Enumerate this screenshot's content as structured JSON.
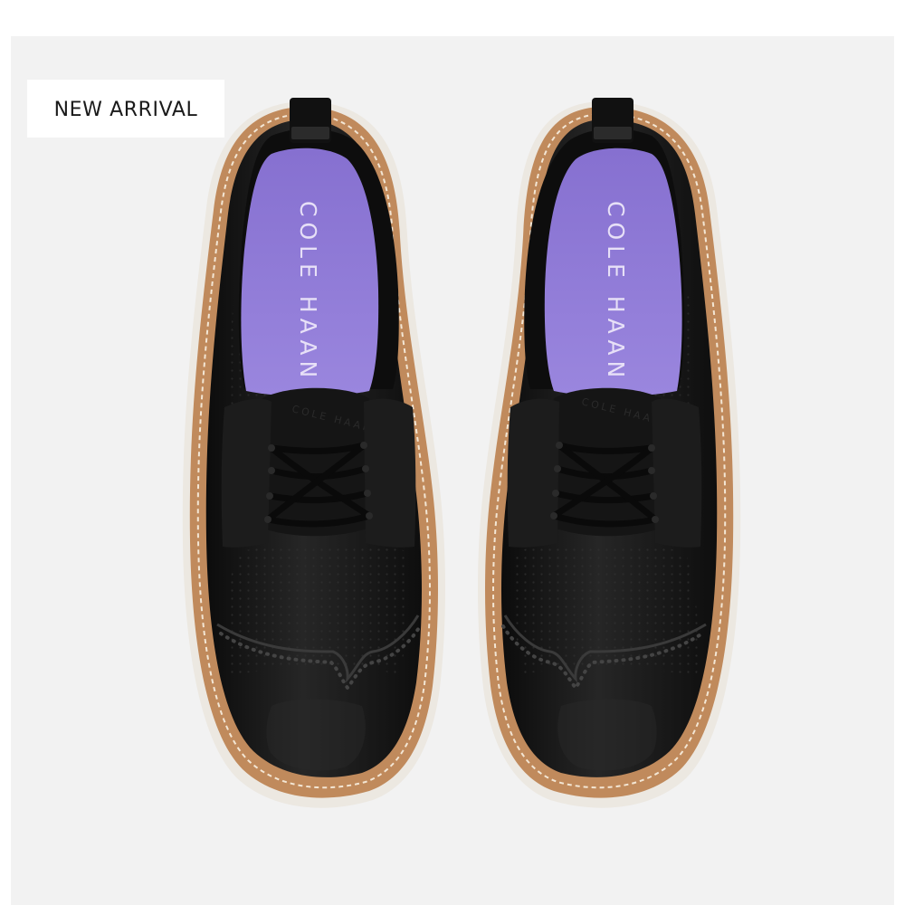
{
  "badge": {
    "label": "NEW ARRIVAL"
  },
  "product": {
    "insole_brand_left": "COLE HAAN",
    "insole_brand_right": "COLE HAAN",
    "tongue_brand_left": "COLE HAAN",
    "tongue_brand_right": "COLE HAAN",
    "upper_color": "#141414",
    "insole_color": "#8e79d6",
    "welt_color": "#c08a5c",
    "sole_color": "#ede9e2"
  }
}
